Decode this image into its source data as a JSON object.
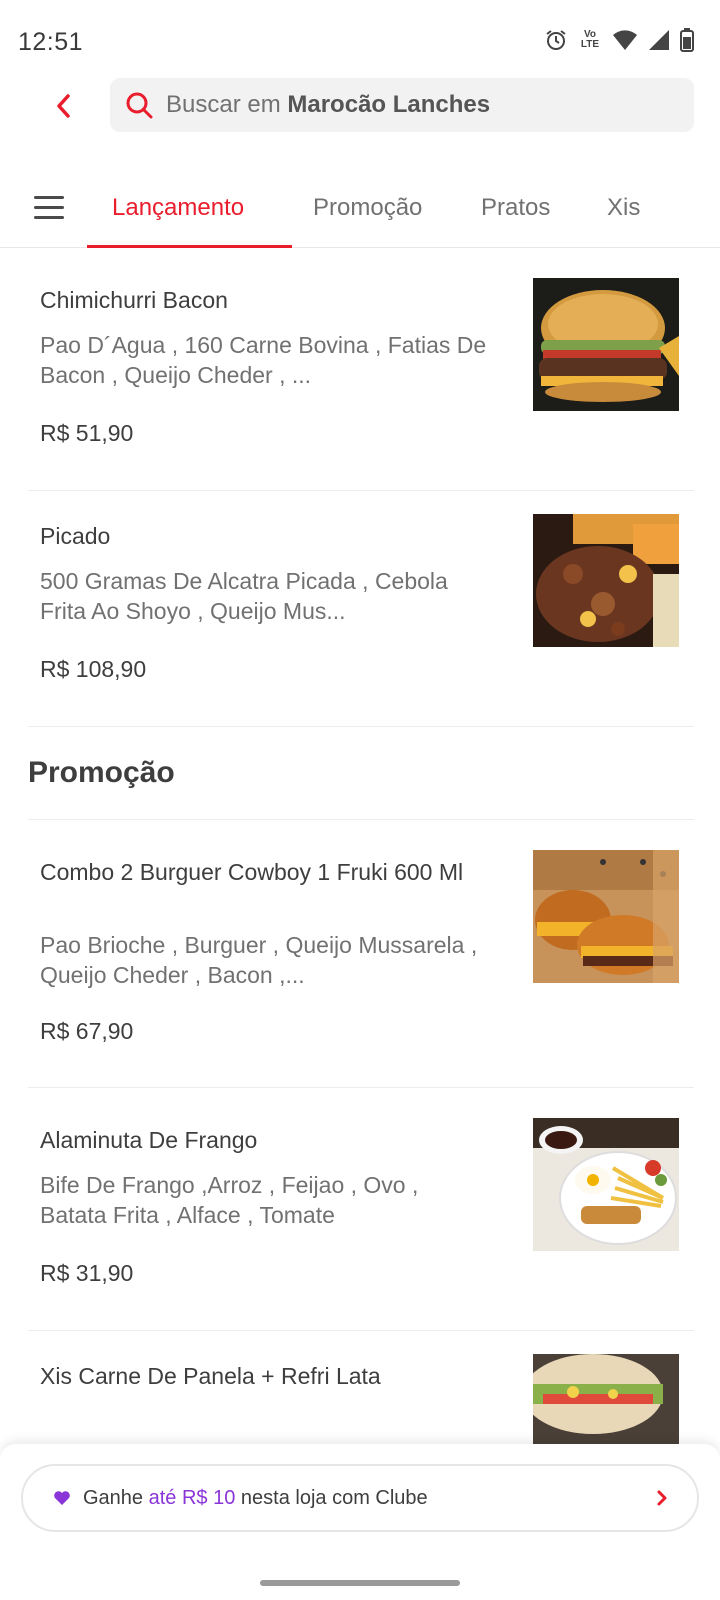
{
  "status_bar": {
    "time": "12:51",
    "icons": [
      "alarm-icon",
      "volte-icon",
      "wifi-icon",
      "signal-icon",
      "battery-icon"
    ],
    "volte_top": "Vo",
    "volte_bottom": "LTE"
  },
  "header": {
    "back_icon": "chevron-left-icon",
    "search_prefix": "Buscar em ",
    "search_store": "Marocão Lanches"
  },
  "tabs": {
    "menu_icon": "hamburger-icon",
    "items": [
      {
        "label": "Lançamento",
        "active": true
      },
      {
        "label": "Promoção",
        "active": false
      },
      {
        "label": "Pratos",
        "active": false
      },
      {
        "label": "Xis",
        "active": false
      }
    ]
  },
  "sections": [
    {
      "title": "",
      "items": [
        {
          "name": "Chimichurri Bacon",
          "description": "Pao D´Agua , 160 Carne Bovina , Fatias De Bacon , Queijo Cheder , ...",
          "price": "R$ 51,90",
          "photo": "burger-photo"
        },
        {
          "name": "Picado",
          "description": "500 Gramas De Alcatra Picada , Cebola Frita Ao Shoyo , Queijo Mus...",
          "price": "R$ 108,90",
          "photo": "picado-photo"
        }
      ]
    },
    {
      "title": "Promoção",
      "items": [
        {
          "name": "Combo 2 Burguer Cowboy 1 Fruki 600 Ml",
          "description": "Pao Brioche , Burguer , Queijo Mussarela , Queijo Cheder , Bacon ,...",
          "price": "R$ 67,90",
          "photo": "combo-burger-box-photo"
        },
        {
          "name": "Alaminuta De Frango",
          "description": "Bife De Frango ,Arroz , Feijao , Ovo , Batata Frita , Alface , Tomate",
          "price": "R$ 31,90",
          "photo": "alaminuta-plate-photo"
        },
        {
          "name": "Xis Carne De Panela + Refri Lata",
          "description": "",
          "price": "",
          "photo": "xis-sandwich-photo"
        }
      ]
    }
  ],
  "club_banner": {
    "icon": "heart-icon",
    "text_before": "Ganhe ",
    "highlight": "até R$ 10",
    "text_after": " nesta loja com Clube",
    "chevron_icon": "chevron-right-icon"
  },
  "colors": {
    "brand_red": "#ea1d2c",
    "club_purple": "#8a35d8",
    "text_primary": "#3e3e3e",
    "text_secondary": "#717171"
  }
}
